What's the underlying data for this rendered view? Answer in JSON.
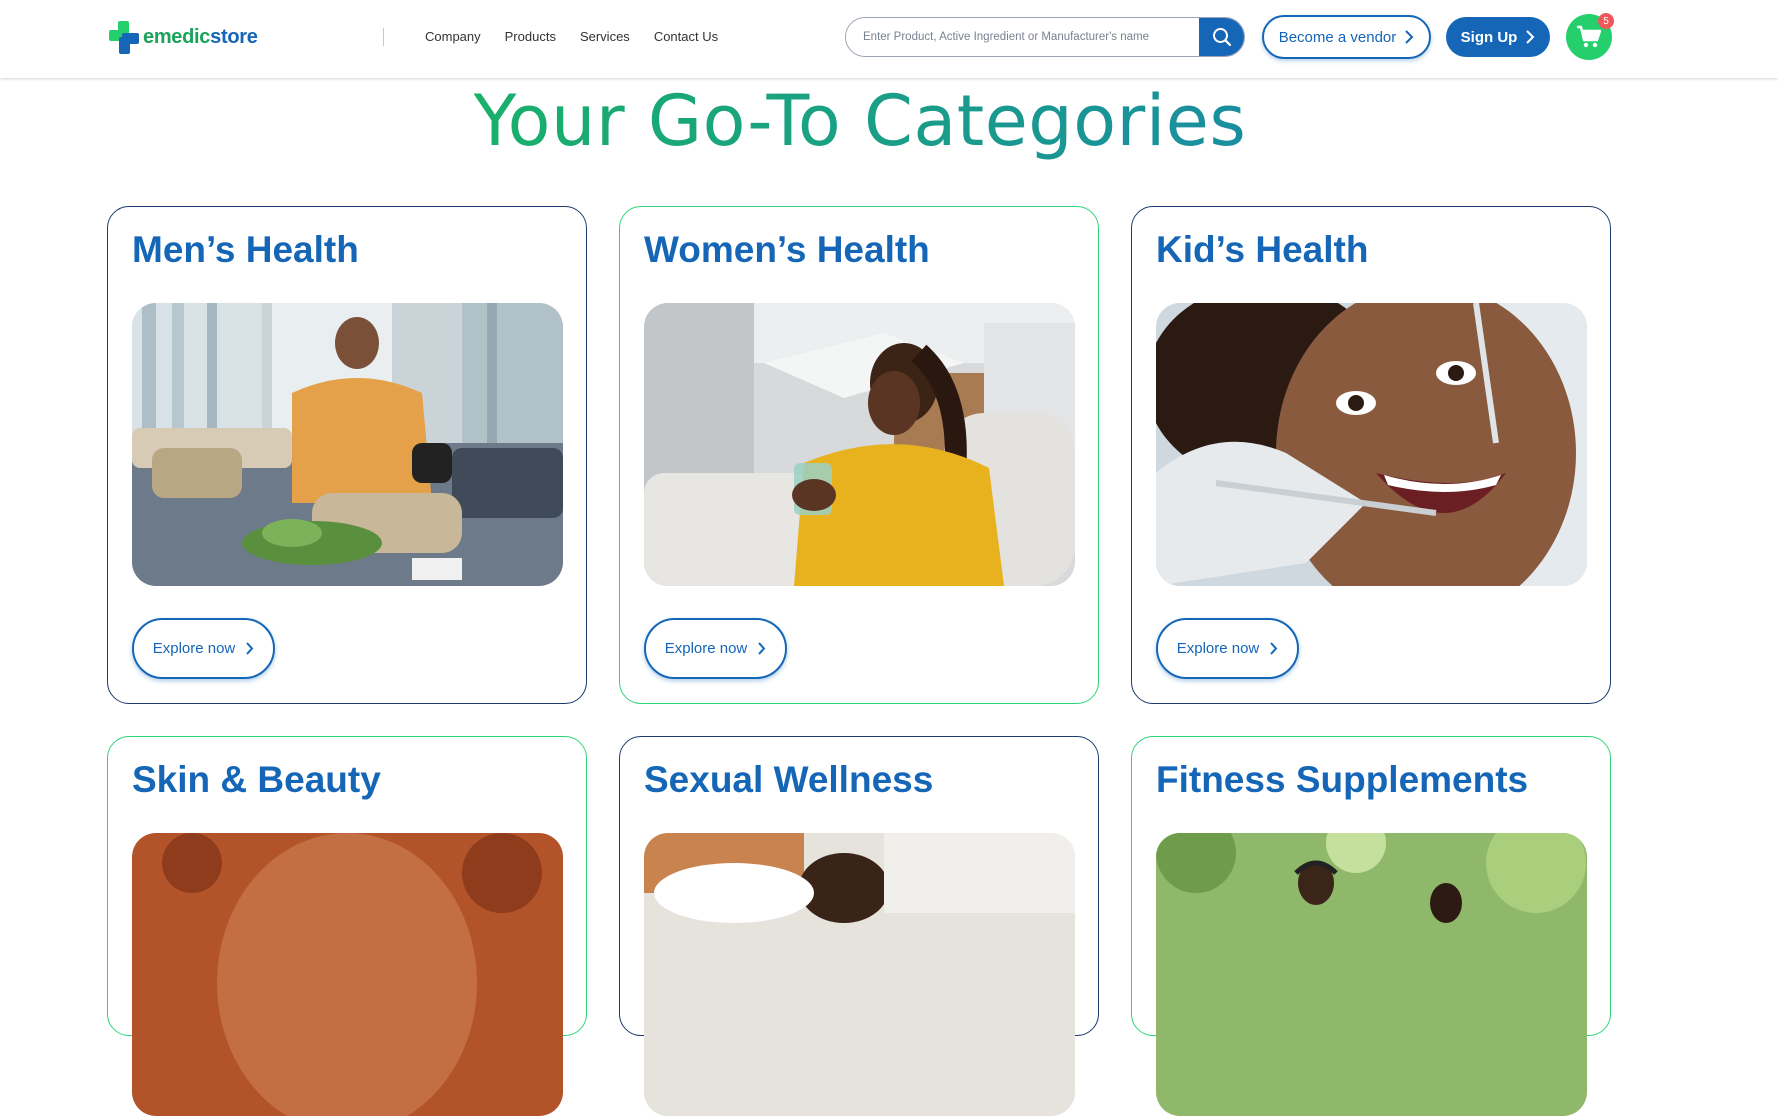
{
  "brand": {
    "name_part1": "emedic",
    "name_part2": "store"
  },
  "nav": [
    "Company",
    "Products",
    "Services",
    "Contact Us"
  ],
  "search": {
    "placeholder": "Enter Product, Active Ingredient or Manufacturer's name"
  },
  "header_actions": {
    "vendor_label": "Become a vendor",
    "signup_label": "Sign Up",
    "cart_count": "5"
  },
  "section": {
    "title": "Your Go-To Categories"
  },
  "categories": [
    {
      "title": "Men’s Health",
      "cta": "Explore now"
    },
    {
      "title": "Women’s Health",
      "cta": "Explore now"
    },
    {
      "title": "Kid’s Health",
      "cta": "Explore now"
    },
    {
      "title": "Skin & Beauty"
    },
    {
      "title": "Sexual Wellness"
    },
    {
      "title": "Fitness Supplements"
    }
  ],
  "colors": {
    "primary_blue": "#1566b7",
    "brand_green": "#25cf6c",
    "heading_green": "#19a56d",
    "card_border_navy": "#1c3a6e",
    "card_border_green": "#2ed47a"
  }
}
